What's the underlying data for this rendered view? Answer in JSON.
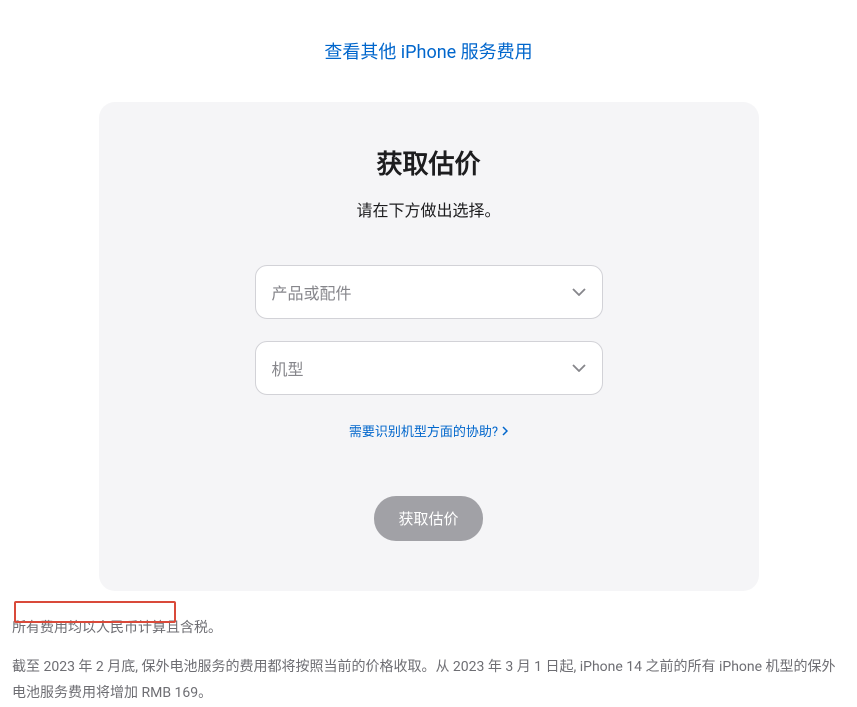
{
  "topLink": {
    "label": "查看其他 iPhone 服务费用"
  },
  "card": {
    "title": "获取估价",
    "subtitle": "请在下方做出选择。",
    "select1": {
      "placeholder": "产品或配件"
    },
    "select2": {
      "placeholder": "机型"
    },
    "helpLink": "需要识别机型方面的协助?",
    "button": "获取估价"
  },
  "footer": {
    "line1": "所有费用均以人民币计算且含税。",
    "line2": "截至 2023 年 2 月底, 保外电池服务的费用都将按照当前的价格收取。从 2023 年 3 月 1 日起, iPhone 14 之前的所有 iPhone 机型的保外电池服务费用将增加 RMB 169。"
  }
}
